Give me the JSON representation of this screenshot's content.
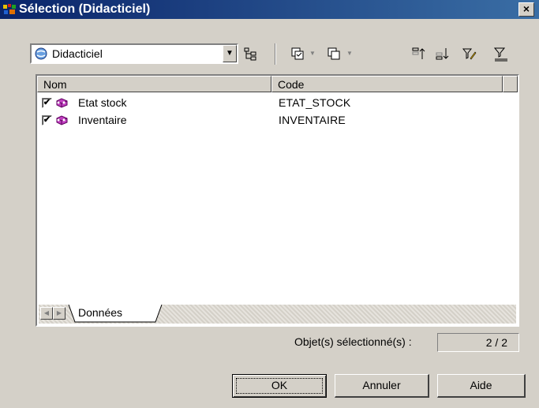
{
  "window": {
    "title": "Sélection (Didacticiel)",
    "close_label": "×"
  },
  "toolbar": {
    "model_combo": {
      "value": "Didacticiel"
    }
  },
  "list": {
    "columns": [
      "Nom",
      "Code"
    ],
    "rows": [
      {
        "checked": true,
        "name": "Etat stock",
        "code": "ETAT_STOCK"
      },
      {
        "checked": true,
        "name": "Inventaire",
        "code": "INVENTAIRE"
      }
    ],
    "tabs": [
      "Données"
    ]
  },
  "status": {
    "selected_label": "Objet(s) sélectionné(s) :",
    "selected_value": "2 / 2"
  },
  "buttons": {
    "ok": "OK",
    "cancel": "Annuler",
    "help": "Aide"
  },
  "colors": {
    "title_bar": "#0a246a",
    "dialog_bg": "#d4d0c8",
    "entity_icon": "#9a2b9a"
  }
}
